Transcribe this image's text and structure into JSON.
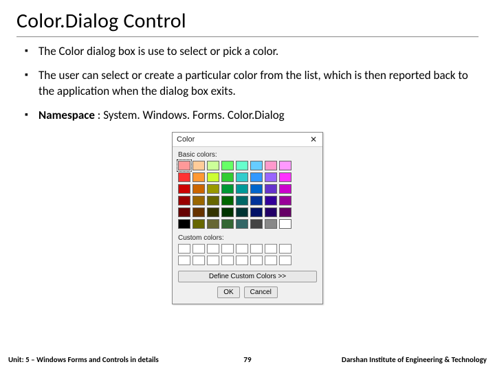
{
  "title": "Color.Dialog Control",
  "bullets": [
    "The Color dialog box is use to select or pick a color.",
    "The user can select or create a particular color from the list, which is then reported back to the application when the dialog box exits."
  ],
  "namespace_label": "Namespace",
  "namespace_value": ": System. Windows. Forms. Color.Dialog",
  "dialog": {
    "title": "Color",
    "close": "✕",
    "basic_label": "Basic colors:",
    "custom_label": "Custom colors:",
    "define_btn": "Define Custom Colors >>",
    "ok": "OK",
    "cancel": "Cancel",
    "basic_colors": [
      "#ff9999",
      "#ffcc99",
      "#ccff99",
      "#66ff66",
      "#66ffcc",
      "#66ccff",
      "#ff99cc",
      "#ff99ff",
      "#ff3333",
      "#ff9933",
      "#ccff33",
      "#33cc33",
      "#33cccc",
      "#3399ff",
      "#9966ff",
      "#ff33ff",
      "#cc0000",
      "#cc6600",
      "#999900",
      "#009933",
      "#009999",
      "#0066cc",
      "#6633cc",
      "#cc00cc",
      "#990000",
      "#996600",
      "#666600",
      "#006600",
      "#006666",
      "#003399",
      "#330099",
      "#990099",
      "#660000",
      "#663300",
      "#333300",
      "#003300",
      "#003333",
      "#001166",
      "#220066",
      "#660066",
      "#000000",
      "#666600",
      "#666633",
      "#336633",
      "#336666",
      "#444444",
      "#888888",
      "#ffffff"
    ],
    "custom_slots": 16
  },
  "footer": {
    "left": "Unit: 5 – Windows Forms and Controls in details",
    "center": "79",
    "right": "Darshan Institute of Engineering & Technology"
  }
}
